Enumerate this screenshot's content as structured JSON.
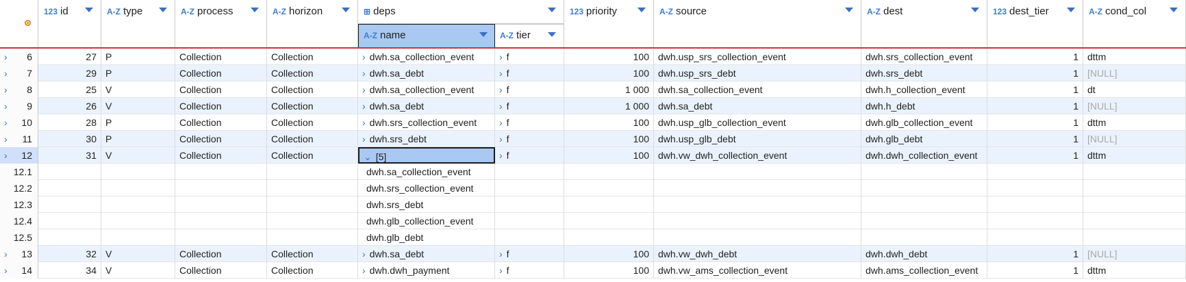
{
  "columns": [
    {
      "type": "123",
      "label": "id"
    },
    {
      "type": "A-Z",
      "label": "type"
    },
    {
      "type": "A-Z",
      "label": "process"
    },
    {
      "type": "A-Z",
      "label": "horizon"
    },
    {
      "type": "",
      "label": "deps"
    },
    {
      "type": "123",
      "label": "priority"
    },
    {
      "type": "A-Z",
      "label": "source"
    },
    {
      "type": "A-Z",
      "label": "dest"
    },
    {
      "type": "123",
      "label": "dest_tier"
    },
    {
      "type": "A-Z",
      "label": "cond_col"
    }
  ],
  "deps_subcolumns": [
    {
      "type": "A-Z",
      "label": "name"
    },
    {
      "type": "A-Z",
      "label": "tier"
    }
  ],
  "rows": [
    {
      "n": "6",
      "id": "27",
      "type": "P",
      "process": "Collection",
      "horizon": "Collection",
      "name": "dwh.sa_collection_event",
      "tier": "f",
      "priority": "100",
      "source": "dwh.usp_srs_collection_event",
      "dest": "dwh.srs_collection_event",
      "dest_tier": "1",
      "cond_col": "dttm"
    },
    {
      "n": "7",
      "id": "29",
      "type": "P",
      "process": "Collection",
      "horizon": "Collection",
      "name": "dwh.sa_debt",
      "tier": "f",
      "priority": "100",
      "source": "dwh.usp_srs_debt",
      "dest": "dwh.srs_debt",
      "dest_tier": "1",
      "cond_col": "[NULL]"
    },
    {
      "n": "8",
      "id": "25",
      "type": "V",
      "process": "Collection",
      "horizon": "Collection",
      "name": "dwh.sa_collection_event",
      "tier": "f",
      "priority": "1 000",
      "source": "dwh.sa_collection_event",
      "dest": "dwh.h_collection_event",
      "dest_tier": "1",
      "cond_col": "dt"
    },
    {
      "n": "9",
      "id": "26",
      "type": "V",
      "process": "Collection",
      "horizon": "Collection",
      "name": "dwh.sa_debt",
      "tier": "f",
      "priority": "1 000",
      "source": "dwh.sa_debt",
      "dest": "dwh.h_debt",
      "dest_tier": "1",
      "cond_col": "[NULL]"
    },
    {
      "n": "10",
      "id": "28",
      "type": "P",
      "process": "Collection",
      "horizon": "Collection",
      "name": "dwh.srs_collection_event",
      "tier": "f",
      "priority": "100",
      "source": "dwh.usp_glb_collection_event",
      "dest": "dwh.glb_collection_event",
      "dest_tier": "1",
      "cond_col": "dttm"
    },
    {
      "n": "11",
      "id": "30",
      "type": "P",
      "process": "Collection",
      "horizon": "Collection",
      "name": "dwh.srs_debt",
      "tier": "f",
      "priority": "100",
      "source": "dwh.usp_glb_debt",
      "dest": "dwh.glb_debt",
      "dest_tier": "1",
      "cond_col": "[NULL]"
    },
    {
      "n": "12",
      "id": "31",
      "type": "V",
      "process": "Collection",
      "horizon": "Collection",
      "name": "[5]",
      "tier": "f",
      "priority": "100",
      "source": "dwh.vw_dwh_collection_event",
      "dest": "dwh.dwh_collection_event",
      "dest_tier": "1",
      "cond_col": "dttm"
    },
    {
      "n": "13",
      "id": "32",
      "type": "V",
      "process": "Collection",
      "horizon": "Collection",
      "name": "dwh.sa_debt",
      "tier": "f",
      "priority": "100",
      "source": "dwh.vw_dwh_debt",
      "dest": "dwh.dwh_debt",
      "dest_tier": "1",
      "cond_col": "[NULL]"
    },
    {
      "n": "14",
      "id": "34",
      "type": "V",
      "process": "Collection",
      "horizon": "Collection",
      "name": "dwh.dwh_payment",
      "tier": "f",
      "priority": "100",
      "source": "dwh.vw_ams_collection_event",
      "dest": "dwh.ams_collection_event",
      "dest_tier": "1",
      "cond_col": "dttm"
    }
  ],
  "subrows": [
    {
      "n": "12.1",
      "name": "dwh.sa_collection_event"
    },
    {
      "n": "12.2",
      "name": "dwh.srs_collection_event"
    },
    {
      "n": "12.3",
      "name": "dwh.srs_debt"
    },
    {
      "n": "12.4",
      "name": "dwh.glb_collection_event"
    },
    {
      "n": "12.5",
      "name": "dwh.glb_debt"
    }
  ]
}
